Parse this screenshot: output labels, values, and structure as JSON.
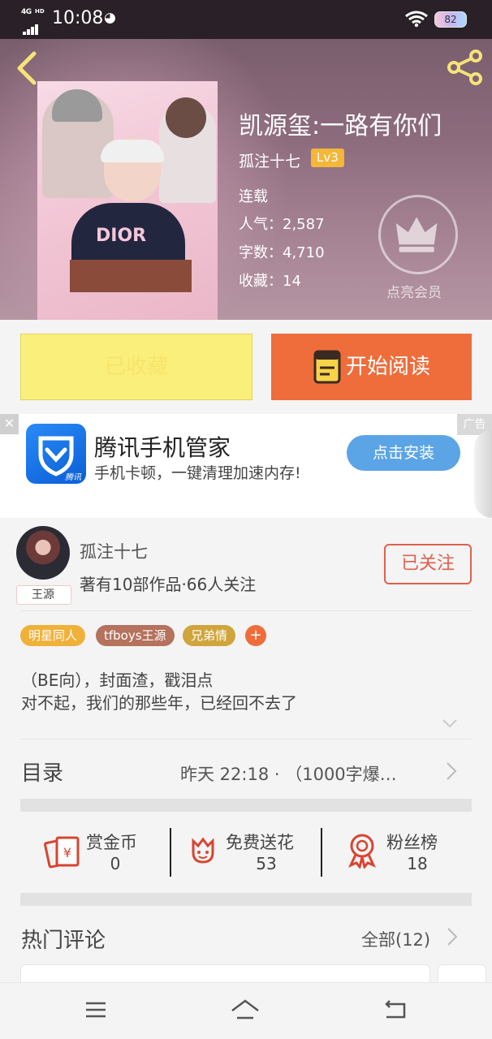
{
  "status_bar": {
    "network": "4G",
    "network_sup": "HD",
    "time": "10:08",
    "battery": "82",
    "icons": [
      "signal-icon",
      "wifi-icon",
      "battery-icon"
    ]
  },
  "header": {
    "book_title": "凯源玺:一路有你们",
    "author": "孤注十七",
    "author_level": "Lv3",
    "status": "连载",
    "popularity_label": "人气：",
    "popularity": "2,587",
    "word_count_label": "字数：",
    "word_count": "4,710",
    "favorites_label": "收藏：",
    "favorites": "14",
    "vip_label": "点亮会员"
  },
  "actions": {
    "favorited_label": "已收藏",
    "read_label": "开始阅读"
  },
  "ad": {
    "close": "✕",
    "tag": "广告",
    "logo_text": "腾讯",
    "title": "腾讯手机管家",
    "subtitle": "手机卡顿，一键清理加速内存!",
    "install_label": "点击安装"
  },
  "author_card": {
    "name": "孤注十七",
    "meta": "著有10部作品·66人关注",
    "avatar_tag": "王源",
    "follow_label": "已关注",
    "tags": [
      {
        "label": "明星同人",
        "color": "#f0b13a"
      },
      {
        "label": "tfboys王源",
        "color": "#b5725d"
      },
      {
        "label": "兄弟情",
        "color": "#cfa53c"
      }
    ],
    "tag_plus": "+",
    "description_line1": "（BE向），封面渣，戳泪点",
    "description_line2": "对不起，我们的那些年，已经回不去了"
  },
  "toc": {
    "title": "目录",
    "latest": "昨天 22:18 · （1000字爆…"
  },
  "stats": {
    "reward_label": "赏金币",
    "reward_value": "0",
    "flower_label": "免费送花",
    "flower_value": "53",
    "fans_label": "粉丝榜",
    "fans_value": "18"
  },
  "comments": {
    "title": "热门评论",
    "all_label": "全部(12)"
  },
  "colors": {
    "accent_orange": "#ee6d3b",
    "favorite_yellow": "#fbef7c",
    "follow_red": "#e0604c",
    "ad_blue": "#5ba4e6"
  }
}
